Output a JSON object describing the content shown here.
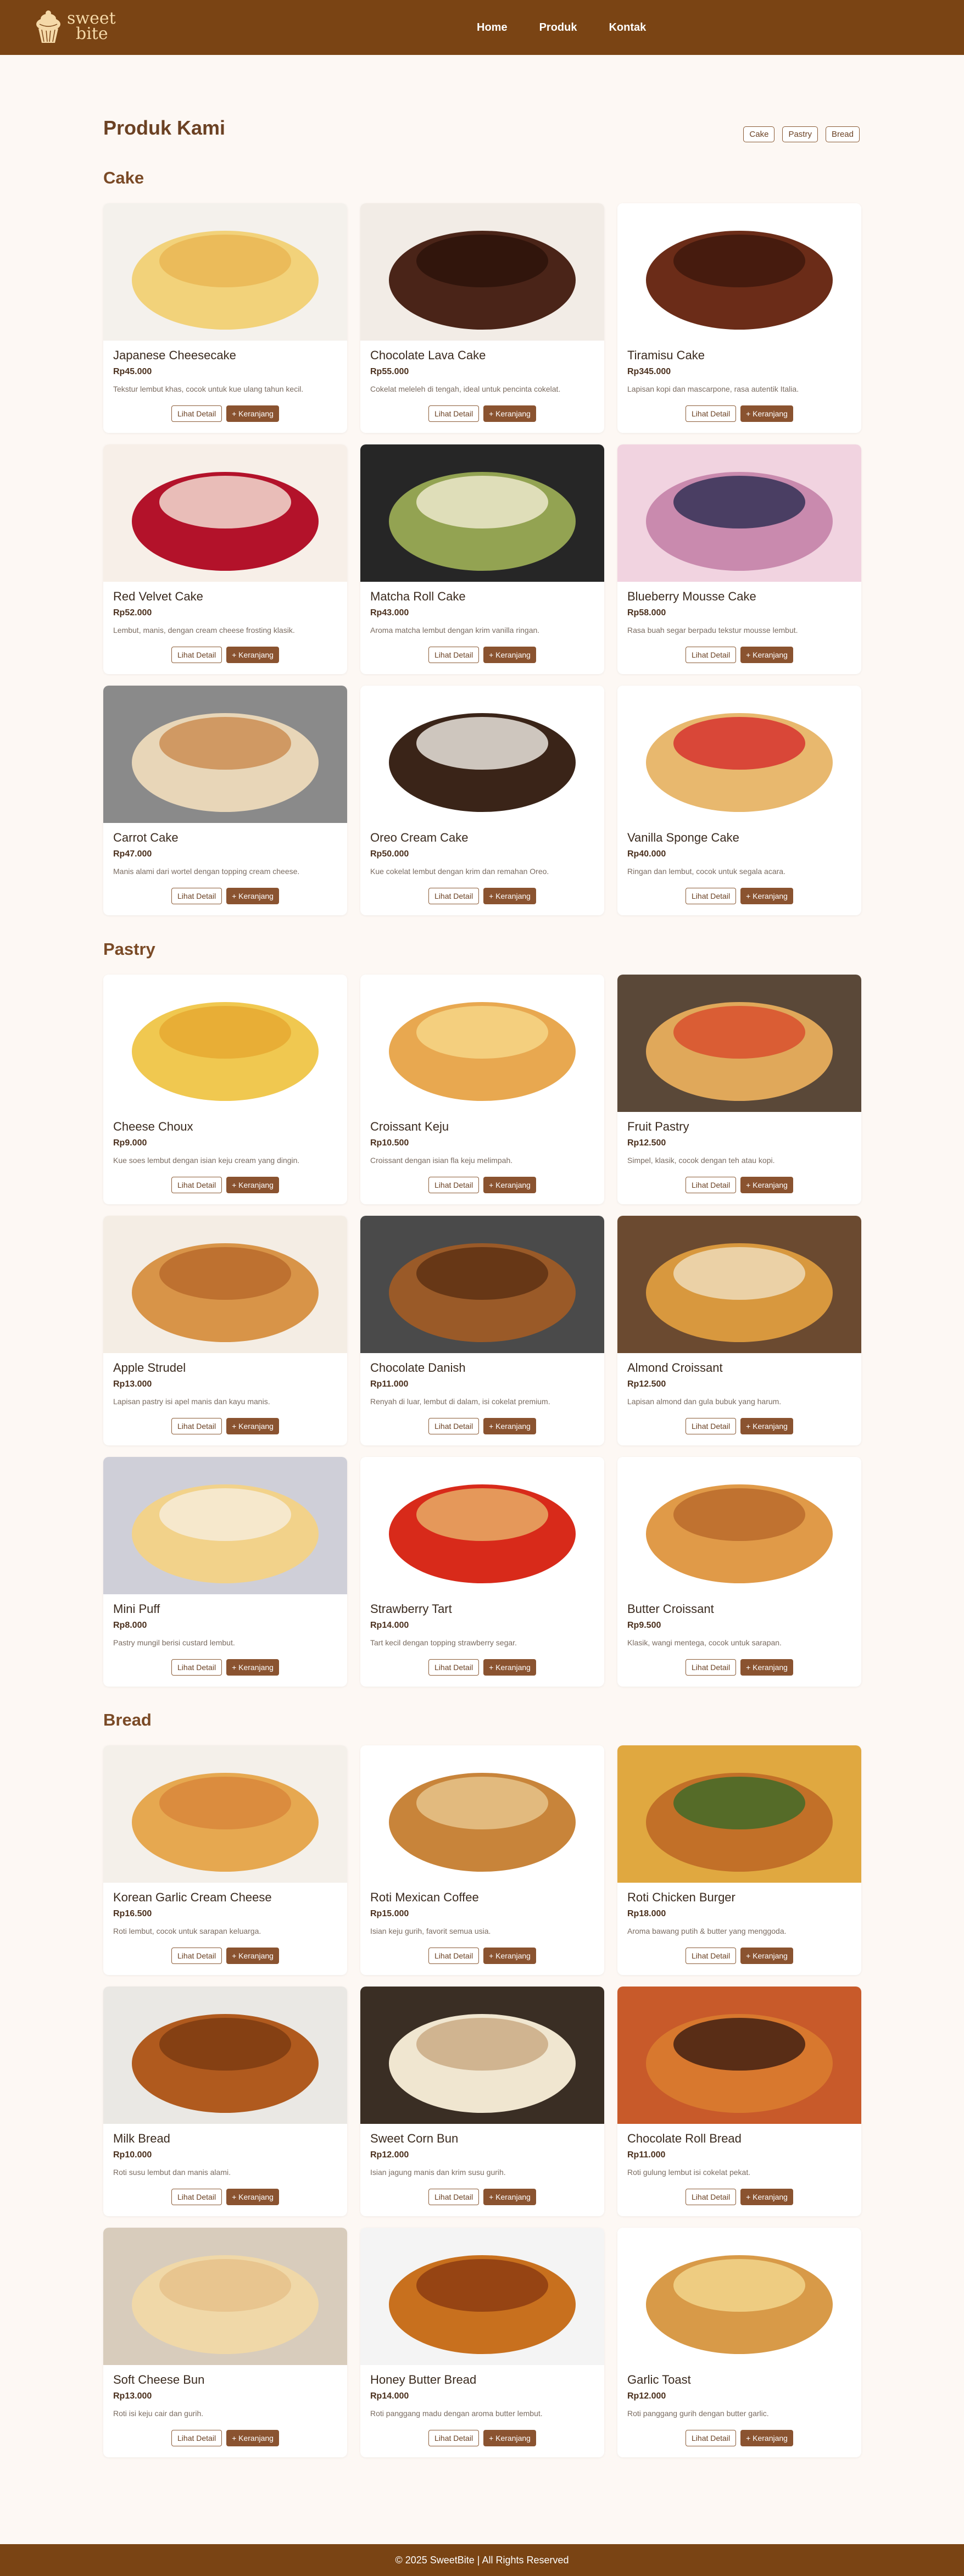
{
  "brand": {
    "line1": "sweet",
    "line2": "bite",
    "logo_icon": "cupcake-icon"
  },
  "nav": {
    "items": [
      "Home",
      "Produk",
      "Kontak"
    ]
  },
  "page_title": "Produk Kami",
  "filters": [
    "Cake",
    "Pastry",
    "Bread"
  ],
  "detail_label": "Lihat Detail",
  "cart_label": "+ Keranjang",
  "sections": [
    {
      "title": "Cake",
      "products": [
        {
          "name": "Japanese Cheesecake",
          "price": "Rp45.000",
          "desc": "Tekstur lembut khas, cocok untuk kue ulang tahun kecil."
        },
        {
          "name": "Chocolate Lava Cake",
          "price": "Rp55.000",
          "desc": "Cokelat meleleh di tengah, ideal untuk pencinta cokelat."
        },
        {
          "name": "Tiramisu Cake",
          "price": "Rp345.000",
          "desc": "Lapisan kopi dan mascarpone, rasa autentik Italia."
        },
        {
          "name": "Red Velvet Cake",
          "price": "Rp52.000",
          "desc": "Lembut, manis, dengan cream cheese frosting klasik."
        },
        {
          "name": "Matcha Roll Cake",
          "price": "Rp43.000",
          "desc": "Aroma matcha lembut dengan krim vanilla ringan."
        },
        {
          "name": "Blueberry Mousse Cake",
          "price": "Rp58.000",
          "desc": "Rasa buah segar berpadu tekstur mousse lembut."
        },
        {
          "name": "Carrot Cake",
          "price": "Rp47.000",
          "desc": "Manis alami dari wortel dengan topping cream cheese."
        },
        {
          "name": "Oreo Cream Cake",
          "price": "Rp50.000",
          "desc": "Kue cokelat lembut dengan krim dan remahan Oreo."
        },
        {
          "name": "Vanilla Sponge Cake",
          "price": "Rp40.000",
          "desc": "Ringan dan lembut, cocok untuk segala acara."
        }
      ]
    },
    {
      "title": "Pastry",
      "products": [
        {
          "name": "Cheese Choux",
          "price": "Rp9.000",
          "desc": "Kue soes lembut dengan isian keju cream yang dingin."
        },
        {
          "name": "Croissant Keju",
          "price": "Rp10.500",
          "desc": "Croissant dengan isian fla keju melimpah."
        },
        {
          "name": "Fruit Pastry",
          "price": "Rp12.500",
          "desc": "Simpel, klasik, cocok dengan teh atau kopi."
        },
        {
          "name": "Apple Strudel",
          "price": "Rp13.000",
          "desc": "Lapisan pastry isi apel manis dan kayu manis."
        },
        {
          "name": "Chocolate Danish",
          "price": "Rp11.000",
          "desc": "Renyah di luar, lembut di dalam, isi cokelat premium."
        },
        {
          "name": "Almond Croissant",
          "price": "Rp12.500",
          "desc": "Lapisan almond dan gula bubuk yang harum."
        },
        {
          "name": "Mini Puff",
          "price": "Rp8.000",
          "desc": "Pastry mungil berisi custard lembut."
        },
        {
          "name": "Strawberry Tart",
          "price": "Rp14.000",
          "desc": "Tart kecil dengan topping strawberry segar."
        },
        {
          "name": "Butter Croissant",
          "price": "Rp9.500",
          "desc": "Klasik, wangi mentega, cocok untuk sarapan."
        }
      ]
    },
    {
      "title": "Bread",
      "products": [
        {
          "name": "Korean Garlic Cream Cheese",
          "price": "Rp16.500",
          "desc": "Roti lembut, cocok untuk sarapan keluarga."
        },
        {
          "name": "Roti Mexican Coffee",
          "price": "Rp15.000",
          "desc": "Isian keju gurih, favorit semua usia."
        },
        {
          "name": "Roti Chicken Burger",
          "price": "Rp18.000",
          "desc": "Aroma bawang putih & butter yang menggoda."
        },
        {
          "name": "Milk Bread",
          "price": "Rp10.000",
          "desc": "Roti susu lembut dan manis alami."
        },
        {
          "name": "Sweet Corn Bun",
          "price": "Rp12.000",
          "desc": "Isian jagung manis dan krim susu gurih."
        },
        {
          "name": "Chocolate Roll Bread",
          "price": "Rp11.000",
          "desc": "Roti gulung lembut isi cokelat pekat."
        },
        {
          "name": "Soft Cheese Bun",
          "price": "Rp13.000",
          "desc": "Roti isi keju cair dan gurih."
        },
        {
          "name": "Honey Butter Bread",
          "price": "Rp14.000",
          "desc": "Roti panggang madu dengan aroma butter lembut."
        },
        {
          "name": "Garlic Toast",
          "price": "Rp12.000",
          "desc": "Roti panggang gurih dengan butter garlic."
        }
      ]
    }
  ],
  "footer": "© 2025 SweetBite | All Rights Reserved"
}
